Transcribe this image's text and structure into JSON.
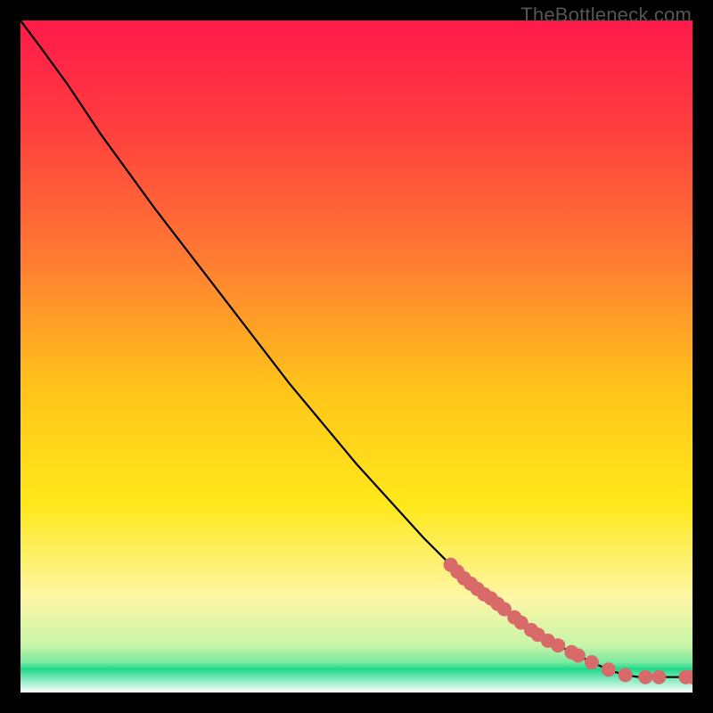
{
  "watermark": "TheBottleneck.com",
  "chart_data": {
    "type": "line",
    "title": "",
    "xlabel": "",
    "ylabel": "",
    "xlim": [
      0,
      100
    ],
    "ylim": [
      0,
      100
    ],
    "gradient_stops": [
      {
        "pos": 0.0,
        "color": "#ff1a4a"
      },
      {
        "pos": 0.15,
        "color": "#ff3b3f"
      },
      {
        "pos": 0.35,
        "color": "#ff7a33"
      },
      {
        "pos": 0.55,
        "color": "#ffc51a"
      },
      {
        "pos": 0.72,
        "color": "#ffe81a"
      },
      {
        "pos": 0.86,
        "color": "#fdf6a6"
      },
      {
        "pos": 0.93,
        "color": "#c7f5a8"
      },
      {
        "pos": 0.955,
        "color": "#7ce9a0"
      },
      {
        "pos": 0.965,
        "color": "#1fd98a"
      },
      {
        "pos": 1.0,
        "color": "#ffffff"
      }
    ],
    "curve": [
      {
        "x": 0,
        "y": 100
      },
      {
        "x": 3,
        "y": 96
      },
      {
        "x": 7,
        "y": 90.5
      },
      {
        "x": 12,
        "y": 83
      },
      {
        "x": 20,
        "y": 72
      },
      {
        "x": 30,
        "y": 59
      },
      {
        "x": 40,
        "y": 46
      },
      {
        "x": 50,
        "y": 34
      },
      {
        "x": 60,
        "y": 23
      },
      {
        "x": 65,
        "y": 18
      },
      {
        "x": 70,
        "y": 14
      },
      {
        "x": 75,
        "y": 10
      },
      {
        "x": 80,
        "y": 7
      },
      {
        "x": 85,
        "y": 4.5
      },
      {
        "x": 88,
        "y": 3.2
      },
      {
        "x": 90,
        "y": 2.6
      },
      {
        "x": 92,
        "y": 2.3
      },
      {
        "x": 94,
        "y": 2.3
      },
      {
        "x": 96,
        "y": 2.3
      },
      {
        "x": 98,
        "y": 2.3
      },
      {
        "x": 100,
        "y": 2.3
      }
    ],
    "markers": [
      {
        "x": 64,
        "y": 19.0
      },
      {
        "x": 65,
        "y": 18.0
      },
      {
        "x": 66,
        "y": 17.0
      },
      {
        "x": 67,
        "y": 16.2
      },
      {
        "x": 68,
        "y": 15.4
      },
      {
        "x": 69,
        "y": 14.6
      },
      {
        "x": 70,
        "y": 14.0
      },
      {
        "x": 71,
        "y": 13.2
      },
      {
        "x": 72,
        "y": 12.4
      },
      {
        "x": 73.5,
        "y": 11.2
      },
      {
        "x": 74.5,
        "y": 10.4
      },
      {
        "x": 76,
        "y": 9.3
      },
      {
        "x": 77,
        "y": 8.6
      },
      {
        "x": 78.5,
        "y": 7.7
      },
      {
        "x": 80,
        "y": 7.0
      },
      {
        "x": 82,
        "y": 6.0
      },
      {
        "x": 83,
        "y": 5.5
      },
      {
        "x": 85,
        "y": 4.5
      },
      {
        "x": 87.5,
        "y": 3.4
      },
      {
        "x": 90,
        "y": 2.6
      },
      {
        "x": 93,
        "y": 2.3
      },
      {
        "x": 95,
        "y": 2.3
      },
      {
        "x": 99,
        "y": 2.3
      },
      {
        "x": 100,
        "y": 2.3
      }
    ],
    "marker_color": "#d86a6a",
    "marker_radius": 8
  }
}
